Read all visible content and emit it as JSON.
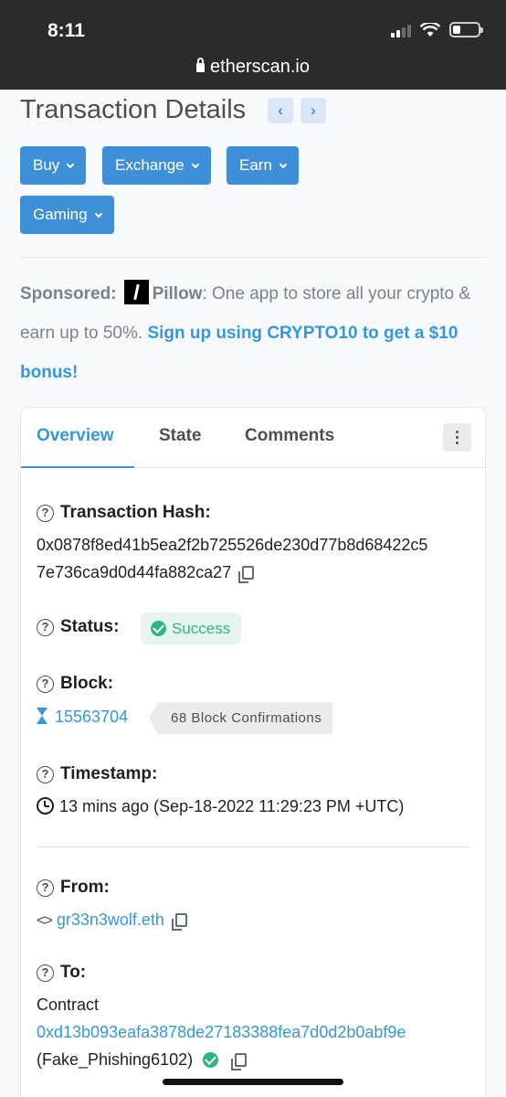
{
  "status_bar": {
    "time": "8:11",
    "battery_percent": 30
  },
  "browser": {
    "url": "etherscan.io"
  },
  "header": {
    "title": "Transaction Details",
    "prev_label": "‹",
    "next_label": "›"
  },
  "menu": [
    {
      "label": "Buy"
    },
    {
      "label": "Exchange"
    },
    {
      "label": "Earn"
    },
    {
      "label": "Gaming"
    }
  ],
  "sponsor": {
    "prefix": "Sponsored:",
    "brand": "Pillow",
    "text": ": One app to store all your crypto & earn up to 50%.",
    "link": "Sign up using CRYPTO10 to get a $10 bonus!"
  },
  "tabs": [
    {
      "label": "Overview",
      "active": true
    },
    {
      "label": "State",
      "active": false
    },
    {
      "label": "Comments",
      "active": false
    }
  ],
  "details": {
    "hash_label": "Transaction Hash:",
    "hash_line1": "0x0878f8ed41b5ea2f2b725526de230d77b8d68422c5",
    "hash_line2": "7e736ca9d0d44fa882ca27",
    "status_label": "Status:",
    "status_value": "Success",
    "block_label": "Block:",
    "block_number": "15563704",
    "confirmations": "68 Block Confirmations",
    "timestamp_label": "Timestamp:",
    "timestamp_value": "13 mins ago (Sep-18-2022 11:29:23 PM +UTC)",
    "from_label": "From:",
    "from_value": "gr33n3wolf.eth",
    "to_label": "To:",
    "to_type": "Contract",
    "to_address": "0xd13b093eafa3878de27183388fea7d0d2b0abf9e",
    "to_name": "(Fake_Phishing6102)"
  },
  "colors": {
    "accent": "#3498db",
    "button": "#3f8fd8",
    "success": "#2eb584"
  }
}
